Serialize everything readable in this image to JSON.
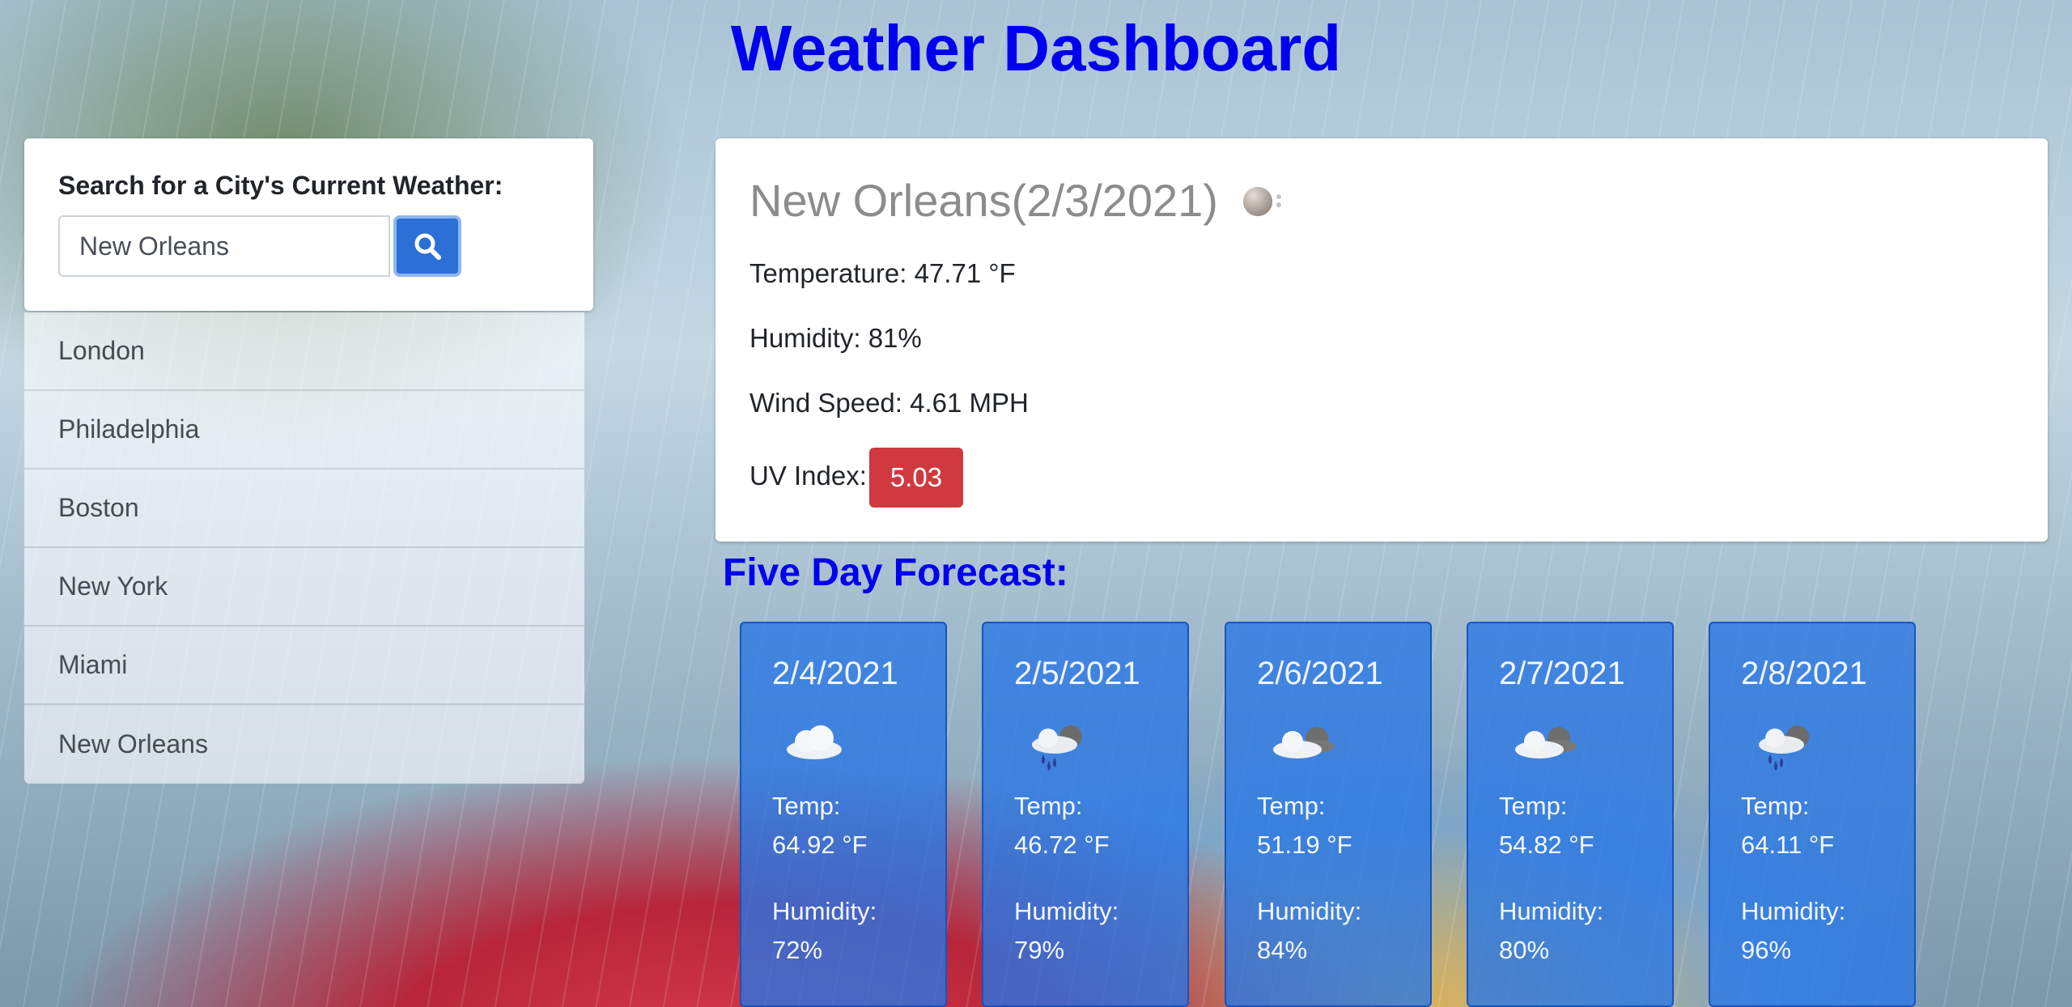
{
  "title": "Weather Dashboard",
  "search": {
    "label": "Search for a City's Current Weather:",
    "value": "New Orleans",
    "button_icon": "search-icon"
  },
  "history": [
    "London",
    "Philadelphia",
    "Boston",
    "New York",
    "Miami",
    "New Orleans"
  ],
  "current": {
    "heading": "New Orleans(2/3/2021)",
    "icon": "fog-moon-icon",
    "temperature": "Temperature: 47.71 °F",
    "humidity": "Humidity: 81%",
    "wind": "Wind Speed: 4.61 MPH",
    "uv_label": "UV Index:",
    "uv_value": "5.03",
    "uv_color": "#d0393f"
  },
  "forecast_heading": "Five Day Forecast:",
  "forecast": [
    {
      "date": "2/4/2021",
      "icon": "cloud-icon",
      "temp_label": "Temp:",
      "temp": "64.92 °F",
      "humidity_label": "Humidity:",
      "humidity": "72%"
    },
    {
      "date": "2/5/2021",
      "icon": "rain-cloud-icon",
      "temp_label": "Temp:",
      "temp": "46.72 °F",
      "humidity_label": "Humidity:",
      "humidity": "79%"
    },
    {
      "date": "2/6/2021",
      "icon": "broken-clouds-icon",
      "temp_label": "Temp:",
      "temp": "51.19 °F",
      "humidity_label": "Humidity:",
      "humidity": "84%"
    },
    {
      "date": "2/7/2021",
      "icon": "broken-clouds-icon",
      "temp_label": "Temp:",
      "temp": "54.82 °F",
      "humidity_label": "Humidity:",
      "humidity": "80%"
    },
    {
      "date": "2/8/2021",
      "icon": "rain-cloud-icon",
      "temp_label": "Temp:",
      "temp": "64.11 °F",
      "humidity_label": "Humidity:",
      "humidity": "96%"
    }
  ],
  "colors": {
    "title": "#0000ee",
    "search_button": "#2c6fd6",
    "forecast_card": "#2676e6"
  }
}
